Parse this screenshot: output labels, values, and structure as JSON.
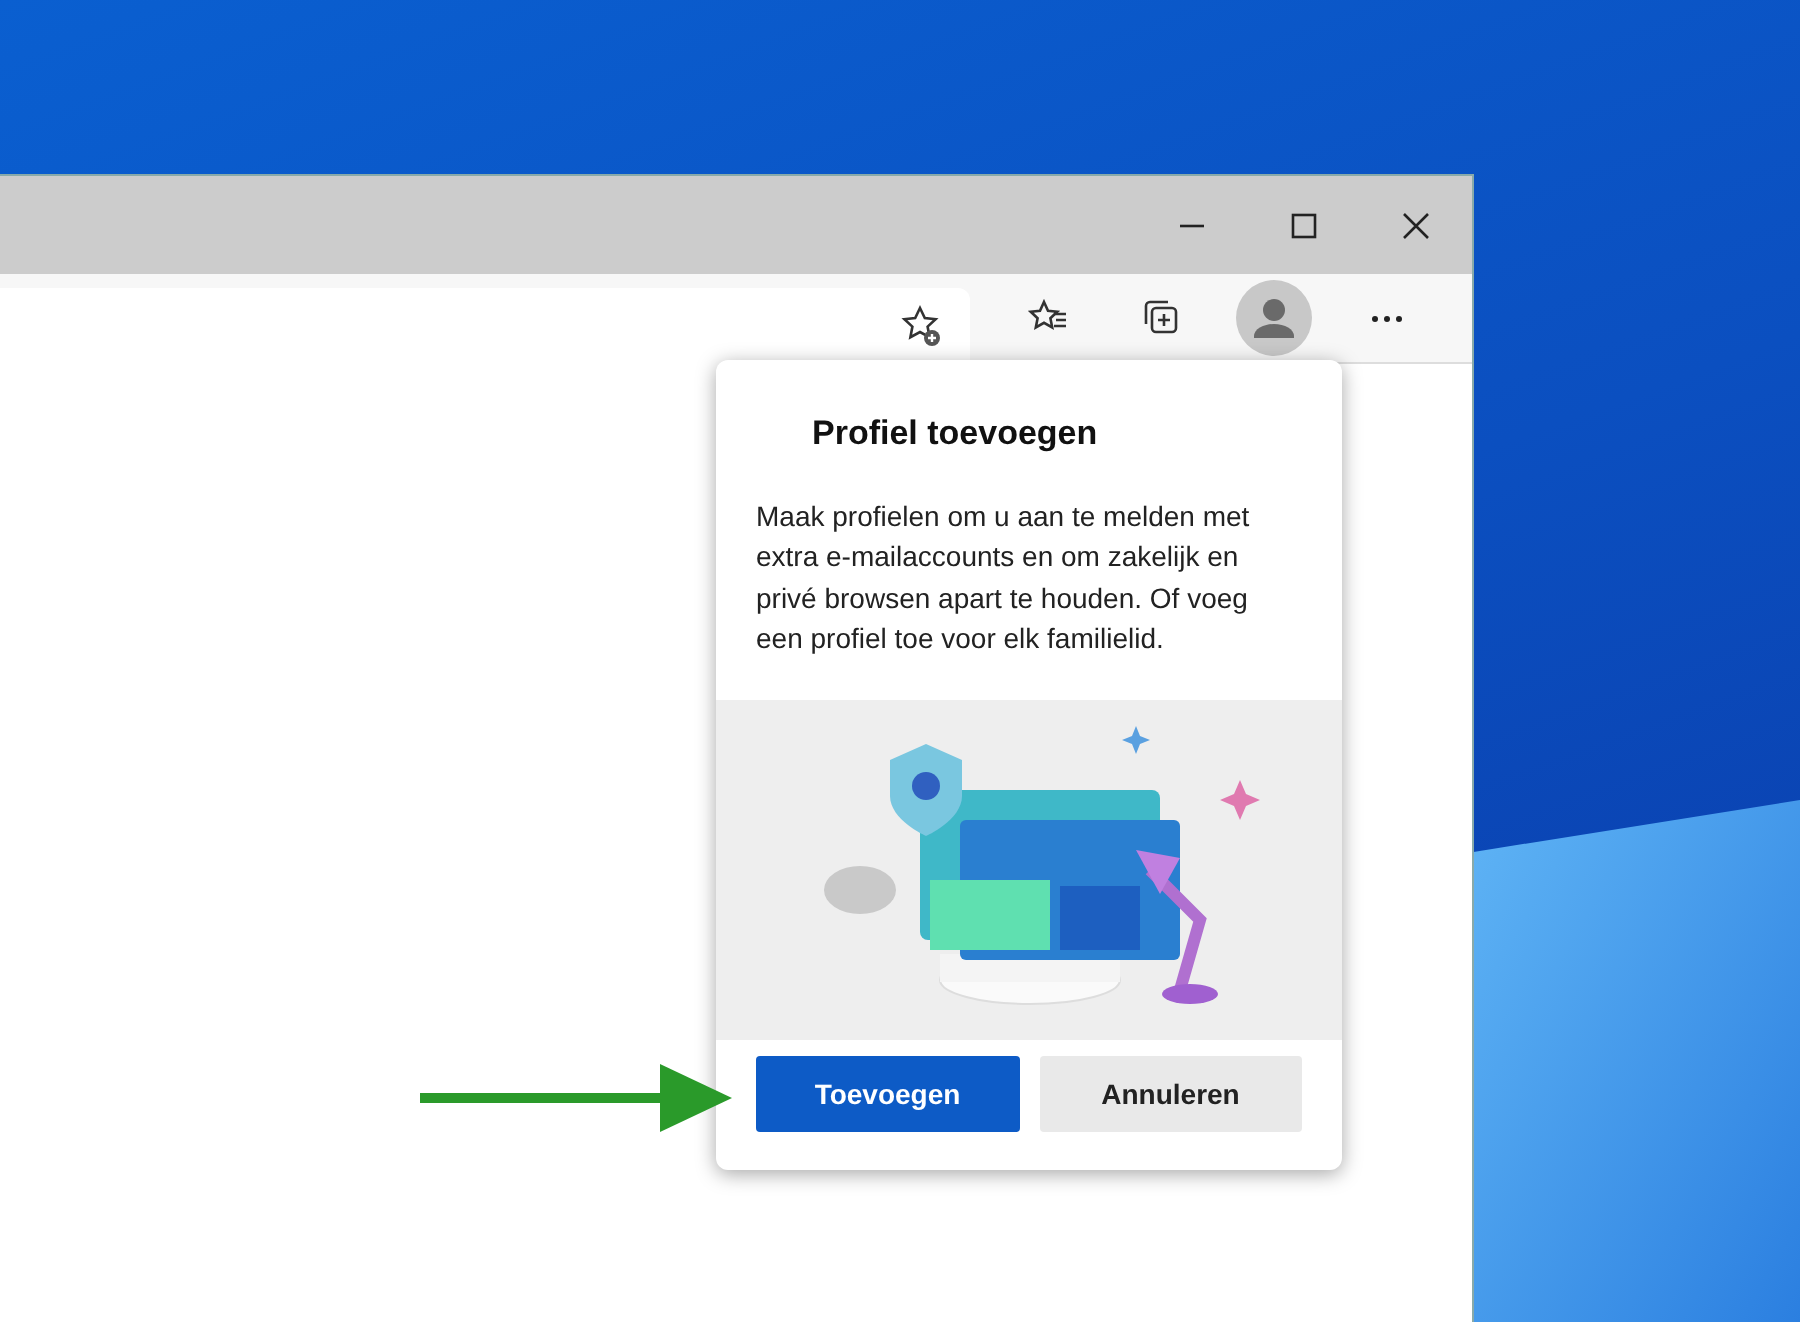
{
  "window": {
    "controls": [
      {
        "kind": "minimize"
      },
      {
        "kind": "maximize"
      },
      {
        "kind": "close"
      }
    ]
  },
  "toolbar": {
    "icons": [
      {
        "kind": "favorite-add"
      },
      {
        "kind": "favorites"
      },
      {
        "kind": "collections"
      },
      {
        "kind": "profile"
      },
      {
        "kind": "more"
      }
    ]
  },
  "popup": {
    "title": "Profiel toevoegen",
    "body": "Maak profielen om u aan te melden met extra e-mailaccounts en om zakelijk en privé browsen apart te houden. Of voeg een profiel toe voor elk familielid.",
    "buttons": [
      {
        "label": "Toevoegen",
        "kind": "primary"
      },
      {
        "label": "Annuleren",
        "kind": "secondary"
      }
    ]
  }
}
